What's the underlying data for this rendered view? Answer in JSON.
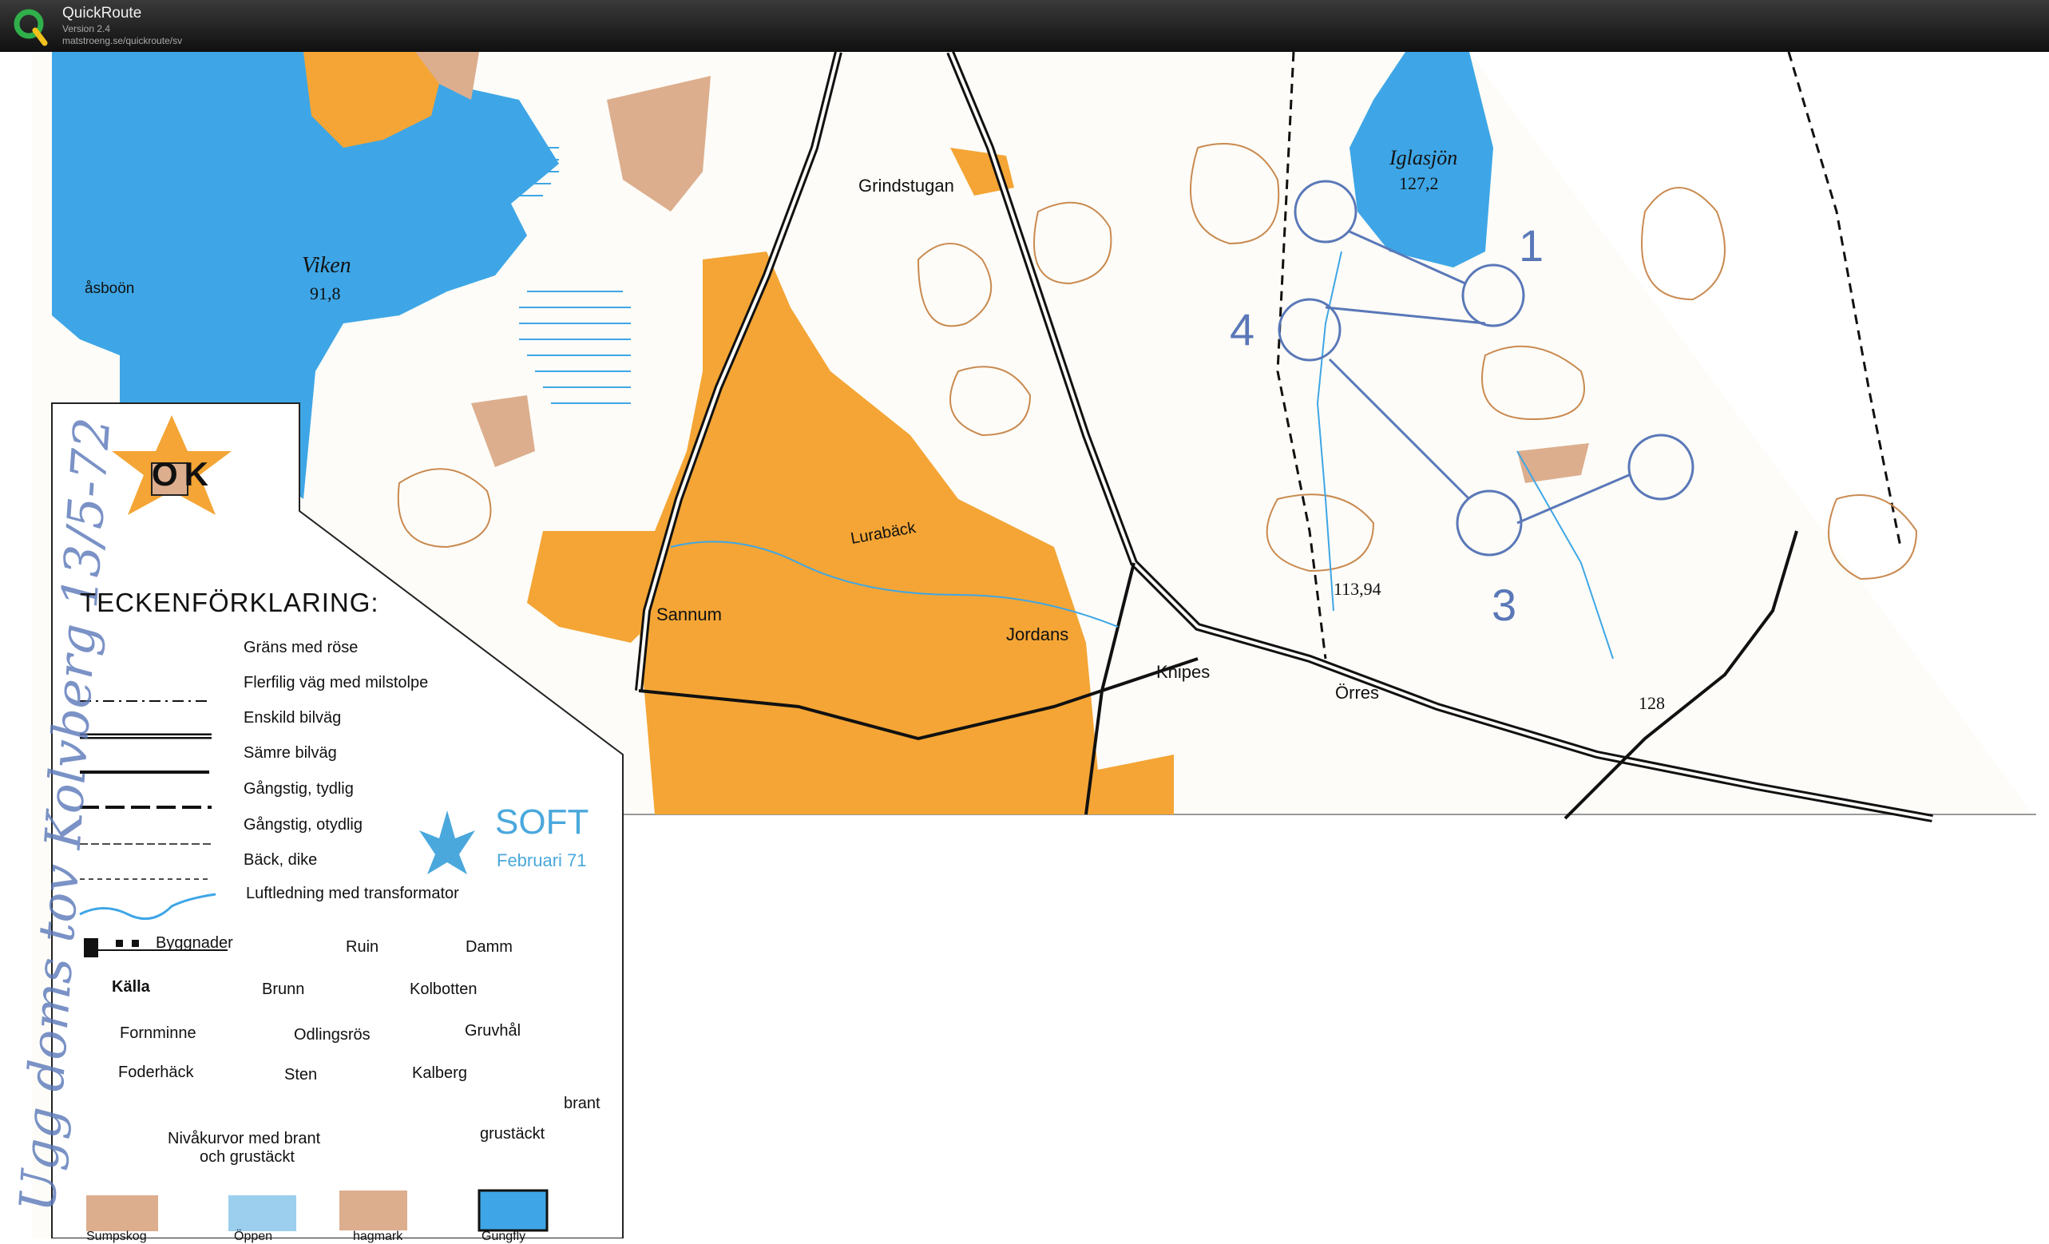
{
  "app": {
    "name": "QuickRoute",
    "version": "Version 2.4",
    "url": "matstroeng.se/quickroute/sv"
  },
  "map": {
    "legend_title": "TECKENFÖRKLARING:",
    "legend_items": {
      "grans": "Gräns med röse",
      "flerfilig": "Flerfilig väg med milstolpe",
      "enskild": "Enskild bilväg",
      "samre": "Sämre bilväg",
      "gangstig_tydlig": "Gångstig, tydlig",
      "gangstig_otydlig": "Gångstig, otydlig",
      "back": "Bäck, dike",
      "luftledning": "Luftledning med transformator",
      "byggnader": "Byggnader",
      "ruin": "Ruin",
      "damm": "Damm",
      "kalla": "Källa",
      "brunn": "Brunn",
      "kolbotten": "Kolbotten",
      "fornminne": "Fornminne",
      "odlingsros": "Odlingsrös",
      "gruvhal": "Gruvhål",
      "foderhack": "Foderhäck",
      "sten": "Sten",
      "kalberg": "Kalberg",
      "brant": "brant",
      "nivakurvor_1": "Nivåkurvor med brant",
      "nivakurvor_2": "och grustäckt",
      "grustackt": "grustäckt",
      "sumpskog": "Sumpskog",
      "oppen": "Öppen",
      "hagmark": "hagmark",
      "gungfly": "Gungfly"
    },
    "club_logo_text": "OK",
    "print_brand": "SOFT",
    "print_date": "Februari 71",
    "places": {
      "viken": "Viken",
      "viken_height": "91,8",
      "iglasjon": "Iglasjön",
      "iglasjon_height": "127,2",
      "grindstugan": "Grindstugan",
      "sannum": "Sannum",
      "lurabäck": "Lurabäck",
      "jordans": "Jordans",
      "knipes": "Knipes",
      "orres": "Örres",
      "asbo": "åsboön",
      "h113": "113,94",
      "h128": "128"
    },
    "course_numbers": [
      "1",
      "3",
      "4"
    ],
    "handwritten": "Ugg doms tov Kolvberg 13/5-72",
    "colors": {
      "water": "#3ea6e6",
      "open_land": "#f4a535",
      "contours": "#c98a50",
      "course": "#5a78b8",
      "titlebar": "#1a1a1a"
    }
  }
}
